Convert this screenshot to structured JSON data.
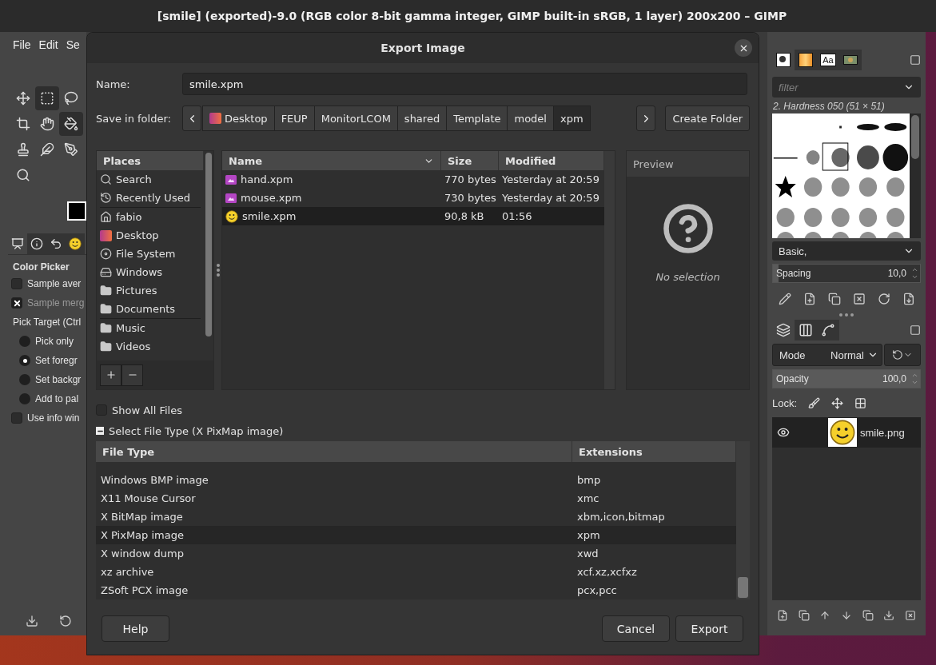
{
  "window": {
    "title": "[smile] (exported)-9.0 (RGB color 8-bit gamma integer, GIMP built-in sRGB, 1 layer) 200x200 – GIMP"
  },
  "menu": [
    "File",
    "Edit",
    "Se"
  ],
  "tools": [
    {
      "kind": "move",
      "selected": false
    },
    {
      "kind": "rect-select",
      "selected": true
    },
    {
      "kind": "lasso",
      "selected": false
    },
    {
      "kind": "crop",
      "selected": false
    },
    {
      "kind": "warp",
      "selected": false
    },
    {
      "kind": "bucket",
      "selected": true
    },
    {
      "kind": "clone",
      "selected": false
    },
    {
      "kind": "smudge",
      "selected": false
    },
    {
      "kind": "paths",
      "selected": false
    },
    {
      "kind": "zoom",
      "selected": false
    }
  ],
  "toolbox_tabs": [
    {
      "kind": "options",
      "selected": true
    },
    {
      "kind": "info",
      "selected": false
    },
    {
      "kind": "undo",
      "selected": false
    },
    {
      "kind": "image",
      "selected": false
    }
  ],
  "tool_options": {
    "title": "Color Picker",
    "items": [
      {
        "kind": "checkbox",
        "label": "Sample aver",
        "checked": false,
        "disabled": false
      },
      {
        "kind": "checkbox",
        "label": "Sample merg",
        "checked": true,
        "disabled": true
      },
      {
        "kind": "heading",
        "label": "Pick Target (Ctrl"
      },
      {
        "kind": "radio",
        "label": "Pick only",
        "selected": false
      },
      {
        "kind": "radio",
        "label": "Set foregr",
        "selected": true
      },
      {
        "kind": "radio",
        "label": "Set backgr",
        "selected": false
      },
      {
        "kind": "radio",
        "label": "Add to pal",
        "selected": false
      },
      {
        "kind": "checkbox",
        "label": "Use info win",
        "checked": false,
        "disabled": false
      }
    ]
  },
  "dialog": {
    "title": "Export Image",
    "name_label": "Name:",
    "name_value": "smile.xpm",
    "folder_label": "Save in folder:",
    "path": [
      {
        "label": "Desktop",
        "kind": "desktop",
        "selected": false
      },
      {
        "label": "FEUP",
        "kind": "folder",
        "selected": false
      },
      {
        "label": "MonitorLCOM",
        "kind": "folder",
        "selected": false
      },
      {
        "label": "shared",
        "kind": "folder",
        "selected": false
      },
      {
        "label": "Template",
        "kind": "folder",
        "selected": false
      },
      {
        "label": "model",
        "kind": "folder",
        "selected": false
      },
      {
        "label": "xpm",
        "kind": "folder",
        "selected": true
      }
    ],
    "create_folder": "Create Folder",
    "places": {
      "title": "Places",
      "groups": [
        [
          {
            "label": "Search",
            "kind": "search"
          },
          {
            "label": "Recently Used",
            "kind": "recent"
          }
        ],
        [
          {
            "label": "fabio",
            "kind": "home"
          },
          {
            "label": "Desktop",
            "kind": "desktop"
          },
          {
            "label": "File System",
            "kind": "disc"
          },
          {
            "label": "Windows",
            "kind": "drive"
          },
          {
            "label": "Pictures",
            "kind": "folder"
          },
          {
            "label": "Documents",
            "kind": "folder"
          }
        ],
        [
          {
            "label": "Music",
            "kind": "folder"
          },
          {
            "label": "Videos",
            "kind": "folder"
          }
        ]
      ]
    },
    "files": {
      "columns": [
        "Name",
        "Size",
        "Modified"
      ],
      "rows": [
        {
          "name": "hand.xpm",
          "kind": "image",
          "size": "770 bytes",
          "modified": "Yesterday at 20:59",
          "selected": false
        },
        {
          "name": "mouse.xpm",
          "kind": "image",
          "size": "730 bytes",
          "modified": "Yesterday at 20:59",
          "selected": false
        },
        {
          "name": "smile.xpm",
          "kind": "smiley",
          "size": "90,8 kB",
          "modified": "01:56",
          "selected": true
        }
      ]
    },
    "preview": {
      "title": "Preview",
      "text": "No selection"
    },
    "show_all_files": {
      "label": "Show All Files",
      "checked": false
    },
    "file_type": {
      "label": "Select File Type (X PixMap image)",
      "expanded": true,
      "columns": [
        "File Type",
        "Extensions"
      ],
      "rows": [
        {
          "type": "Windows BMP image",
          "ext": "bmp",
          "selected": false
        },
        {
          "type": "X11 Mouse Cursor",
          "ext": "xmc",
          "selected": false
        },
        {
          "type": "X BitMap image",
          "ext": "xbm,icon,bitmap",
          "selected": false
        },
        {
          "type": "X PixMap image",
          "ext": "xpm",
          "selected": true
        },
        {
          "type": "X window dump",
          "ext": "xwd",
          "selected": false
        },
        {
          "type": "xz archive",
          "ext": "xcf.xz,xcfxz",
          "selected": false
        },
        {
          "type": "ZSoft PCX image",
          "ext": "pcx,pcc",
          "selected": false
        }
      ]
    },
    "buttons": {
      "help": "Help",
      "cancel": "Cancel",
      "export": "Export"
    }
  },
  "dock": {
    "tabs": [
      {
        "kind": "brush",
        "selected": true
      },
      {
        "kind": "gradient",
        "selected": false
      },
      {
        "kind": "font",
        "label": "Aa",
        "selected": false
      },
      {
        "kind": "pattern",
        "selected": false
      }
    ],
    "filter": {
      "placeholder": "filter"
    },
    "brush_name": "2. Hardness 050 (51 × 51)",
    "brush_set": "Basic,",
    "spacing": {
      "label": "Spacing",
      "value": "10,0",
      "level": 0.04
    },
    "layer_tabs": [
      {
        "kind": "layers",
        "selected": true
      },
      {
        "kind": "channels",
        "selected": false
      },
      {
        "kind": "paths",
        "selected": false
      }
    ],
    "mode": {
      "label": "Mode",
      "value": "Normal"
    },
    "opacity": {
      "label": "Opacity",
      "value": "100,0",
      "level": 1
    },
    "lock_label": "Lock:",
    "layers": [
      {
        "name": "smile.png",
        "visible": true,
        "selected": true
      }
    ]
  }
}
